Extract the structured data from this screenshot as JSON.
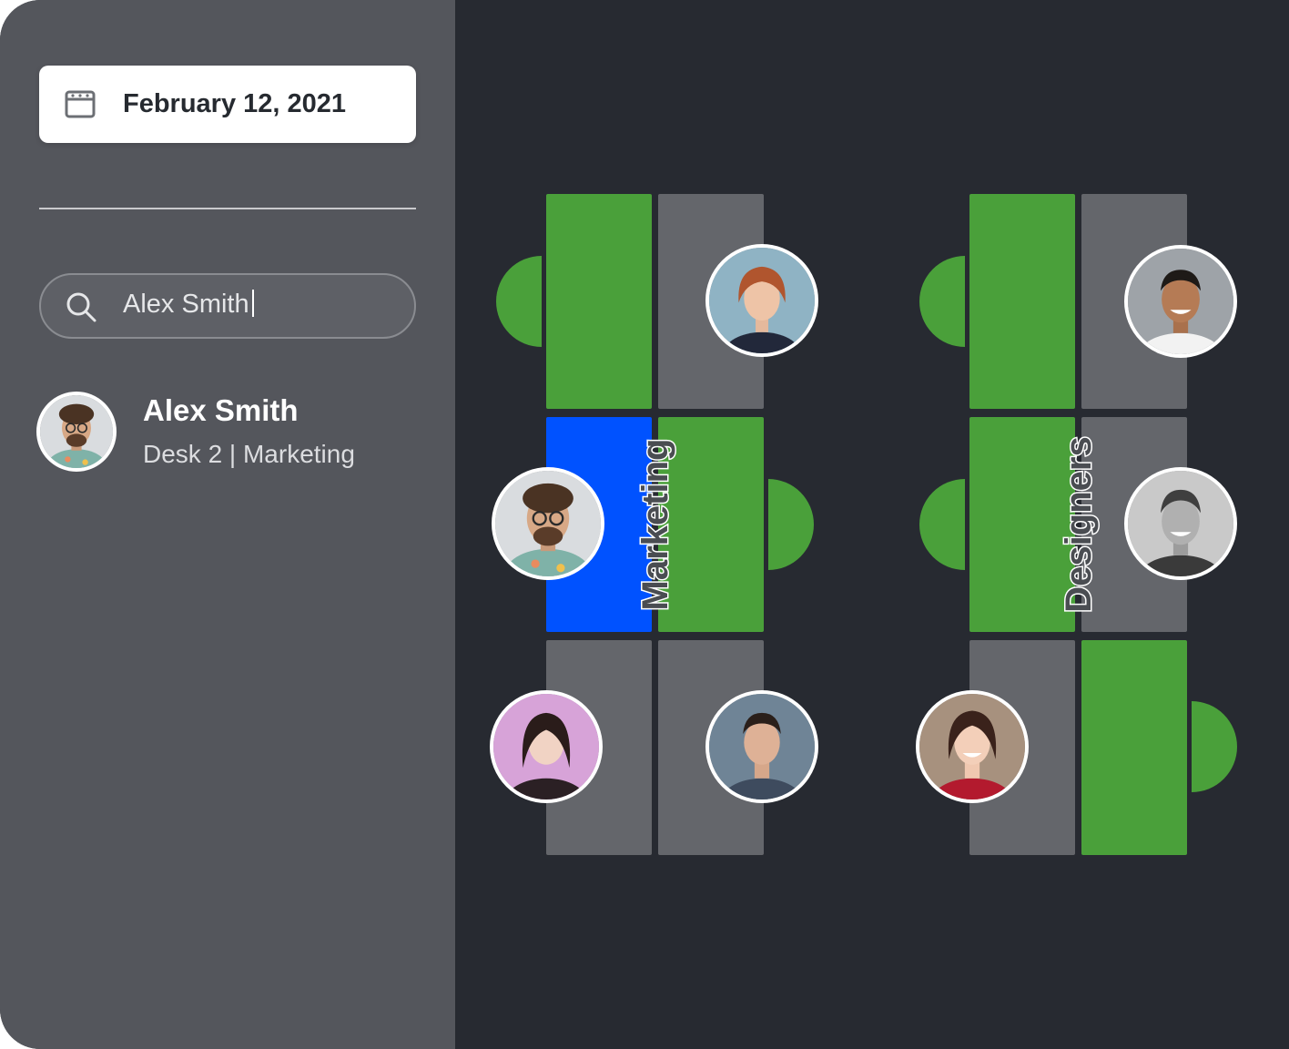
{
  "sidebar": {
    "date": {
      "label": "February 12, 2021",
      "icon": "calendar-icon"
    },
    "search": {
      "icon": "search-icon",
      "value": "Alex Smith"
    },
    "result": {
      "name": "Alex Smith",
      "detail": "Desk 2 | Marketing",
      "avatar": "alex-smith-avatar"
    }
  },
  "floorplan": {
    "teams": [
      {
        "label": "Marketing"
      },
      {
        "label": "Designers"
      }
    ],
    "legend_colors": {
      "free": "#4aa03a",
      "taken": "#64666b",
      "selected": "#0052ff"
    },
    "desk_status": {
      "marketing": [
        "free",
        "taken",
        "selected",
        "free",
        "taken",
        "taken"
      ],
      "designers": [
        "free",
        "taken",
        "free",
        "taken",
        "taken",
        "free"
      ]
    }
  },
  "colors": {
    "sidebar_bg": "#54565c",
    "canvas_bg": "#272a31",
    "free": "#4aa03a",
    "taken": "#64666b",
    "selected": "#0052ff"
  }
}
